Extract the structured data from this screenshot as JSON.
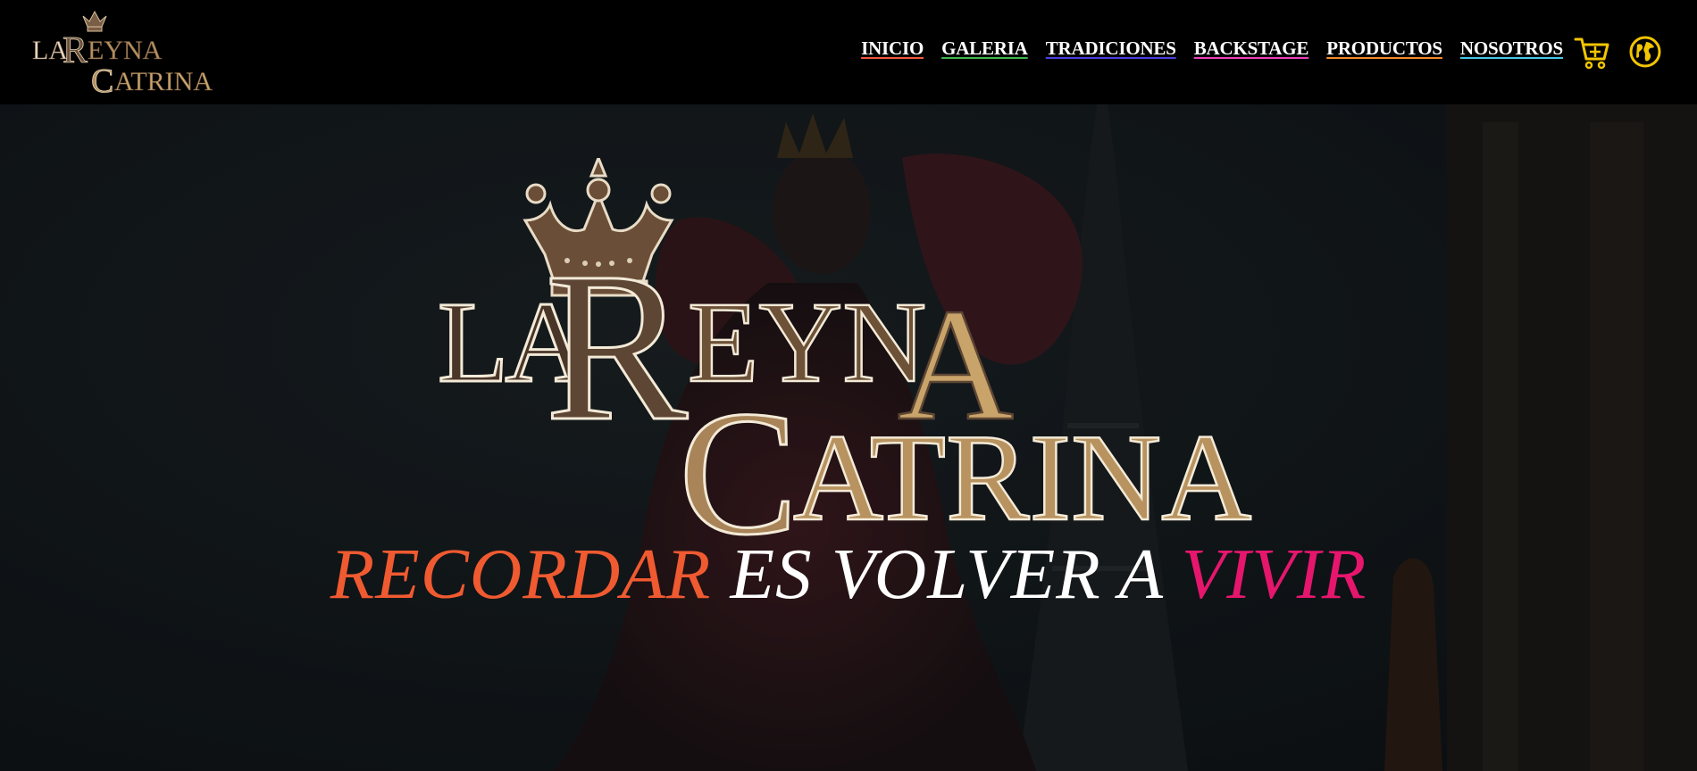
{
  "brand": {
    "logo_line1": "LaReyna",
    "logo_line2": "Catrina",
    "logo_text": "LAREYNA CATRINA"
  },
  "nav": {
    "items": [
      {
        "label": "INICIO",
        "underline": "#f0583a"
      },
      {
        "label": "GALERIA",
        "underline": "#3fb44a"
      },
      {
        "label": "TRADICIONES",
        "underline": "#4a3fe0"
      },
      {
        "label": "BACKSTAGE",
        "underline": "#e940b8"
      },
      {
        "label": "PRODUCTOS",
        "underline": "#f28a2a"
      },
      {
        "label": "NOSOTROS",
        "underline": "#46c6e8"
      }
    ],
    "cart_icon": "cart-plus-icon",
    "language_icon": "globe-icon"
  },
  "hero": {
    "tagline_part1": "RECORDAR",
    "tagline_part2": "ES VOLVER A",
    "tagline_part3": "VIVIR",
    "colors": {
      "accent_orange": "#f05a31",
      "accent_pink": "#e6166d",
      "logo_brown": "#5e4634",
      "logo_gold": "#c9a46a"
    }
  }
}
